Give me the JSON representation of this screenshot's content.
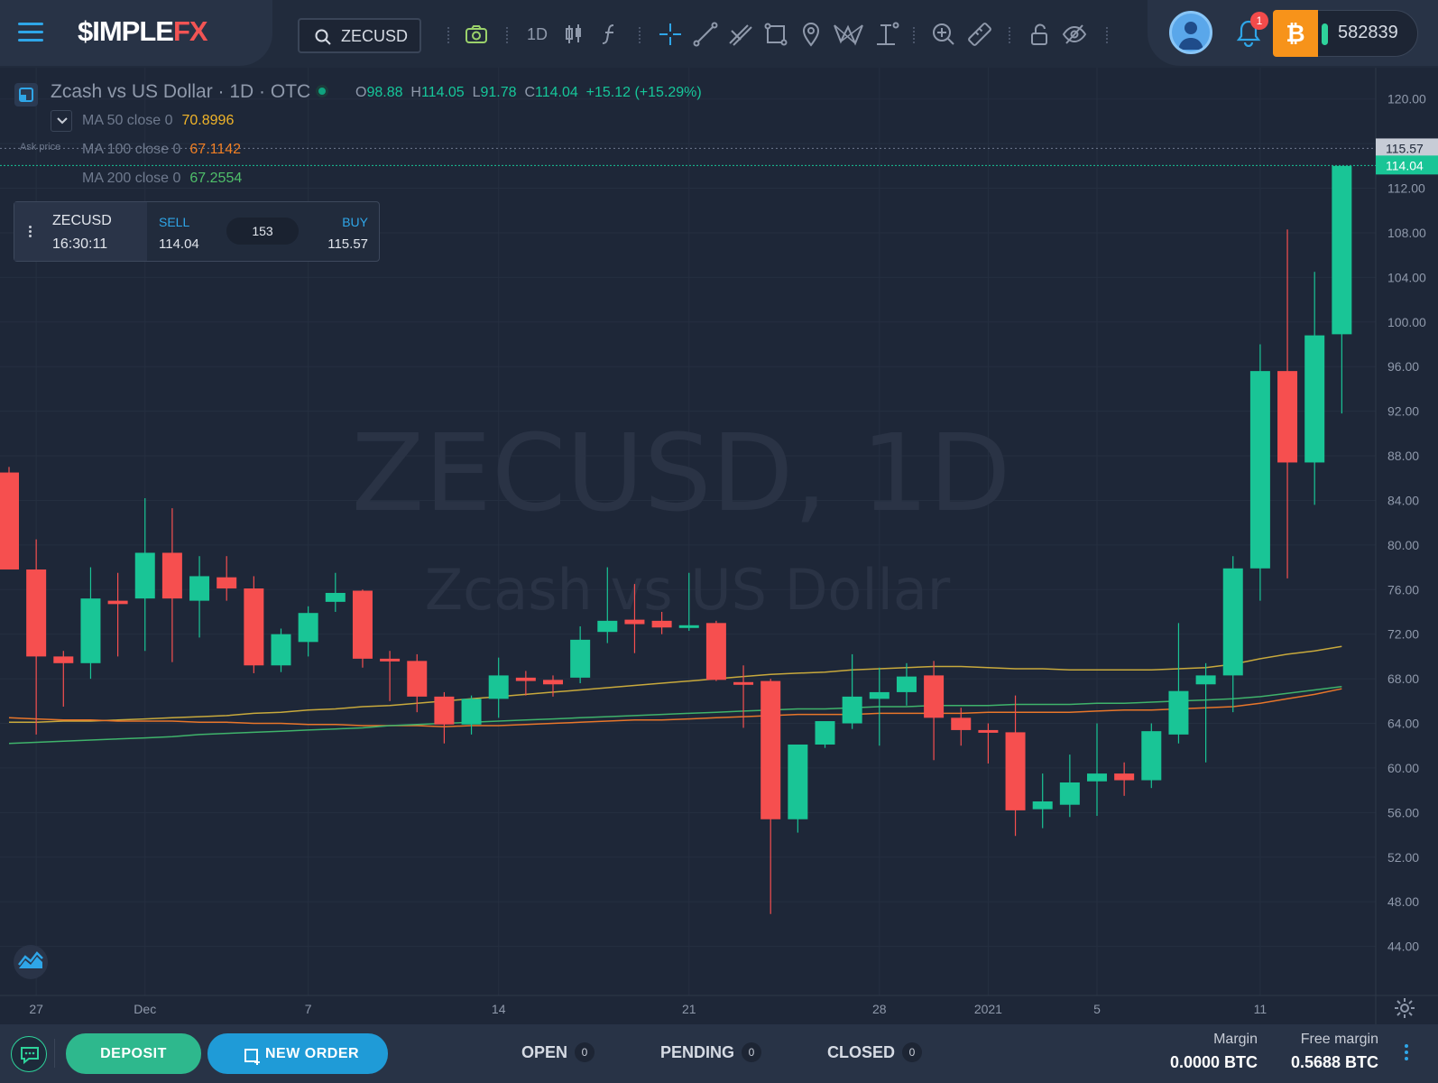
{
  "app": {
    "brand_main": "$IMPLE",
    "brand_accent": "FX"
  },
  "toolbar": {
    "symbol_search": "ZECUSD",
    "interval": "1D",
    "icons": [
      "camera-icon",
      "candles-icon",
      "indicators-icon",
      "crosshair-icon",
      "trend-line-icon",
      "fib-icon",
      "rectangle-icon",
      "marker-icon",
      "pattern-icon",
      "measure-icon",
      "zoom-in-icon",
      "ruler-icon",
      "lock-icon",
      "hide-icon"
    ]
  },
  "account": {
    "notifications": "1",
    "balance": "582839",
    "currency_icon": "bitcoin-icon"
  },
  "legend": {
    "title": "Zcash vs US Dollar · 1D · OTC",
    "o_label": "O",
    "o": "98.88",
    "h_label": "H",
    "h": "114.05",
    "l_label": "L",
    "l": "91.78",
    "c_label": "C",
    "c": "114.04",
    "change": "+15.12 (+15.29%)",
    "ask_label": "Ask price",
    "ma": [
      {
        "label": "MA 50 close 0",
        "value": "70.8996",
        "color": "#f0b429"
      },
      {
        "label": "MA 100 close 0",
        "value": "67.1142",
        "color": "#f07f24"
      },
      {
        "label": "MA 200 close 0",
        "value": "67.2554",
        "color": "#4fbf6a"
      }
    ]
  },
  "trade": {
    "symbol": "ZECUSD",
    "time": "16:30:11",
    "sell_label": "SELL",
    "sell": "114.04",
    "spread": "153",
    "buy_label": "BUY",
    "buy": "115.57"
  },
  "watermark": {
    "symbol": "ZECUSD, 1D",
    "name": "Zcash vs US Dollar"
  },
  "chart_data": {
    "type": "candlestick",
    "y_range": [
      40,
      122
    ],
    "y_ticks": [
      44,
      48,
      52,
      56,
      60,
      64,
      68,
      72,
      76,
      80,
      84,
      88,
      92,
      96,
      100,
      104,
      108,
      112,
      116,
      120
    ],
    "y_tick_labels": [
      "44.00",
      "48.00",
      "52.00",
      "56.00",
      "60.00",
      "64.00",
      "68.00",
      "72.00",
      "76.00",
      "80.00",
      "84.00",
      "88.00",
      "92.00",
      "96.00",
      "100.00",
      "104.00",
      "108.00",
      "112.00",
      "",
      "120.00"
    ],
    "x_labels": [
      {
        "label": "27",
        "index": 1
      },
      {
        "label": "Dec",
        "index": 5
      },
      {
        "label": "7",
        "index": 11
      },
      {
        "label": "14",
        "index": 18
      },
      {
        "label": "21",
        "index": 25
      },
      {
        "label": "28",
        "index": 32
      },
      {
        "label": "2021",
        "index": 36
      },
      {
        "label": "5",
        "index": 40
      },
      {
        "label": "11",
        "index": 46
      }
    ],
    "price_labels": {
      "ask": "115.57",
      "bid": "114.04",
      "ask_value": 115.57,
      "bid_value": 114.04
    },
    "up_color": "#19c596",
    "down_color": "#f64f4f",
    "candles": [
      {
        "o": 86.5,
        "h": 87.0,
        "l": 78.0,
        "c": 77.8
      },
      {
        "o": 77.8,
        "h": 80.5,
        "l": 63.0,
        "c": 70.0
      },
      {
        "o": 70.0,
        "h": 70.5,
        "l": 65.5,
        "c": 69.4
      },
      {
        "o": 69.4,
        "h": 78.0,
        "l": 68.0,
        "c": 75.2
      },
      {
        "o": 75.0,
        "h": 77.5,
        "l": 70.0,
        "c": 74.7
      },
      {
        "o": 75.2,
        "h": 84.2,
        "l": 70.5,
        "c": 79.3
      },
      {
        "o": 79.3,
        "h": 83.3,
        "l": 69.5,
        "c": 75.2
      },
      {
        "o": 75.0,
        "h": 79.0,
        "l": 71.7,
        "c": 77.2
      },
      {
        "o": 77.1,
        "h": 79.0,
        "l": 75.0,
        "c": 76.1
      },
      {
        "o": 76.1,
        "h": 77.2,
        "l": 68.5,
        "c": 69.2
      },
      {
        "o": 69.2,
        "h": 72.5,
        "l": 68.6,
        "c": 72.0
      },
      {
        "o": 71.3,
        "h": 74.5,
        "l": 70.0,
        "c": 73.9
      },
      {
        "o": 74.9,
        "h": 77.5,
        "l": 74.0,
        "c": 75.7
      },
      {
        "o": 75.9,
        "h": 76.0,
        "l": 69.0,
        "c": 69.8
      },
      {
        "o": 69.8,
        "h": 70.5,
        "l": 66.0,
        "c": 69.6
      },
      {
        "o": 69.6,
        "h": 70.2,
        "l": 65.0,
        "c": 66.4
      },
      {
        "o": 66.4,
        "h": 66.8,
        "l": 62.2,
        "c": 63.9
      },
      {
        "o": 63.9,
        "h": 66.5,
        "l": 63.0,
        "c": 66.2
      },
      {
        "o": 66.2,
        "h": 69.9,
        "l": 64.5,
        "c": 68.3
      },
      {
        "o": 68.1,
        "h": 68.7,
        "l": 66.5,
        "c": 67.8
      },
      {
        "o": 67.9,
        "h": 68.3,
        "l": 66.4,
        "c": 67.5
      },
      {
        "o": 68.1,
        "h": 72.7,
        "l": 67.6,
        "c": 71.5
      },
      {
        "o": 72.2,
        "h": 78.0,
        "l": 71.2,
        "c": 73.2
      },
      {
        "o": 73.3,
        "h": 76.5,
        "l": 70.3,
        "c": 72.9
      },
      {
        "o": 73.2,
        "h": 74.0,
        "l": 72.0,
        "c": 72.6
      },
      {
        "o": 72.8,
        "h": 77.5,
        "l": 72.3,
        "c": 72.8
      },
      {
        "o": 73.0,
        "h": 73.2,
        "l": 67.8,
        "c": 67.9
      },
      {
        "o": 67.7,
        "h": 69.2,
        "l": 63.6,
        "c": 67.5
      },
      {
        "o": 67.8,
        "h": 68.0,
        "l": 46.9,
        "c": 55.4
      },
      {
        "o": 55.4,
        "h": 62.0,
        "l": 54.2,
        "c": 62.1
      },
      {
        "o": 62.1,
        "h": 64.0,
        "l": 61.8,
        "c": 64.2
      },
      {
        "o": 64.0,
        "h": 70.2,
        "l": 63.5,
        "c": 66.4
      },
      {
        "o": 66.2,
        "h": 69.0,
        "l": 62.0,
        "c": 66.8
      },
      {
        "o": 66.8,
        "h": 69.4,
        "l": 65.6,
        "c": 68.2
      },
      {
        "o": 68.3,
        "h": 69.6,
        "l": 60.7,
        "c": 64.5
      },
      {
        "o": 64.5,
        "h": 65.4,
        "l": 62.0,
        "c": 63.4
      },
      {
        "o": 63.4,
        "h": 64.0,
        "l": 60.4,
        "c": 63.2
      },
      {
        "o": 63.2,
        "h": 66.5,
        "l": 53.9,
        "c": 56.2
      },
      {
        "o": 56.3,
        "h": 59.5,
        "l": 54.6,
        "c": 57.0
      },
      {
        "o": 56.7,
        "h": 61.2,
        "l": 55.6,
        "c": 58.7
      },
      {
        "o": 58.8,
        "h": 64.0,
        "l": 55.7,
        "c": 59.5
      },
      {
        "o": 59.5,
        "h": 60.5,
        "l": 57.5,
        "c": 58.9
      },
      {
        "o": 58.9,
        "h": 64.0,
        "l": 58.2,
        "c": 63.3
      },
      {
        "o": 63.0,
        "h": 73.0,
        "l": 62.2,
        "c": 66.9
      },
      {
        "o": 67.5,
        "h": 69.4,
        "l": 60.5,
        "c": 68.3
      },
      {
        "o": 68.3,
        "h": 79.0,
        "l": 65.0,
        "c": 77.9
      },
      {
        "o": 77.9,
        "h": 98.0,
        "l": 75.0,
        "c": 95.6
      },
      {
        "o": 95.6,
        "h": 108.3,
        "l": 77.0,
        "c": 87.4
      },
      {
        "o": 87.4,
        "h": 104.5,
        "l": 83.6,
        "c": 98.8
      },
      {
        "o": 98.9,
        "h": 114.0,
        "l": 91.8,
        "c": 114.0
      }
    ],
    "ma_series": [
      {
        "name": "MA 50 close 0",
        "color": "#c8a93c",
        "values": [
          64.1,
          64.1,
          64.2,
          64.2,
          64.3,
          64.4,
          64.5,
          64.6,
          64.7,
          64.9,
          65.0,
          65.2,
          65.3,
          65.5,
          65.6,
          65.8,
          66.0,
          66.2,
          66.4,
          66.6,
          66.8,
          67.0,
          67.2,
          67.4,
          67.6,
          67.8,
          68.0,
          68.2,
          68.4,
          68.5,
          68.6,
          68.8,
          68.9,
          69.0,
          69.1,
          69.1,
          69.0,
          68.9,
          68.9,
          68.8,
          68.8,
          68.8,
          68.8,
          68.9,
          69.0,
          69.3,
          69.8,
          70.2,
          70.5,
          70.9
        ]
      },
      {
        "name": "MA 100 close 0",
        "color": "#e8762a",
        "values": [
          64.5,
          64.4,
          64.3,
          64.3,
          64.2,
          64.2,
          64.2,
          64.1,
          64.1,
          64.0,
          64.0,
          63.9,
          63.9,
          63.8,
          63.8,
          63.8,
          63.7,
          63.8,
          63.8,
          63.9,
          64.0,
          64.1,
          64.2,
          64.3,
          64.3,
          64.4,
          64.5,
          64.6,
          64.7,
          64.8,
          64.8,
          64.8,
          64.9,
          64.9,
          64.9,
          64.9,
          65.0,
          65.0,
          65.0,
          65.0,
          65.1,
          65.2,
          65.2,
          65.3,
          65.4,
          65.5,
          65.8,
          66.2,
          66.6,
          67.1
        ]
      },
      {
        "name": "MA 200 close 0",
        "color": "#3fb36b",
        "values": [
          62.2,
          62.3,
          62.4,
          62.5,
          62.6,
          62.7,
          62.8,
          63.0,
          63.1,
          63.2,
          63.3,
          63.4,
          63.5,
          63.6,
          63.8,
          63.9,
          64.0,
          64.1,
          64.2,
          64.3,
          64.4,
          64.5,
          64.6,
          64.7,
          64.8,
          64.9,
          65.0,
          65.1,
          65.2,
          65.3,
          65.3,
          65.4,
          65.5,
          65.5,
          65.6,
          65.6,
          65.6,
          65.7,
          65.7,
          65.7,
          65.8,
          65.8,
          65.9,
          66.0,
          66.1,
          66.2,
          66.4,
          66.7,
          67.0,
          67.3
        ]
      }
    ]
  },
  "bottom": {
    "deposit": "DEPOSIT",
    "new_order": "NEW ORDER",
    "tabs": [
      {
        "label": "OPEN",
        "count": "0"
      },
      {
        "label": "PENDING",
        "count": "0"
      },
      {
        "label": "CLOSED",
        "count": "0"
      }
    ],
    "margin_label": "Margin",
    "margin": "0.0000 BTC",
    "free_margin_label": "Free margin",
    "free_margin": "0.5688 BTC"
  }
}
